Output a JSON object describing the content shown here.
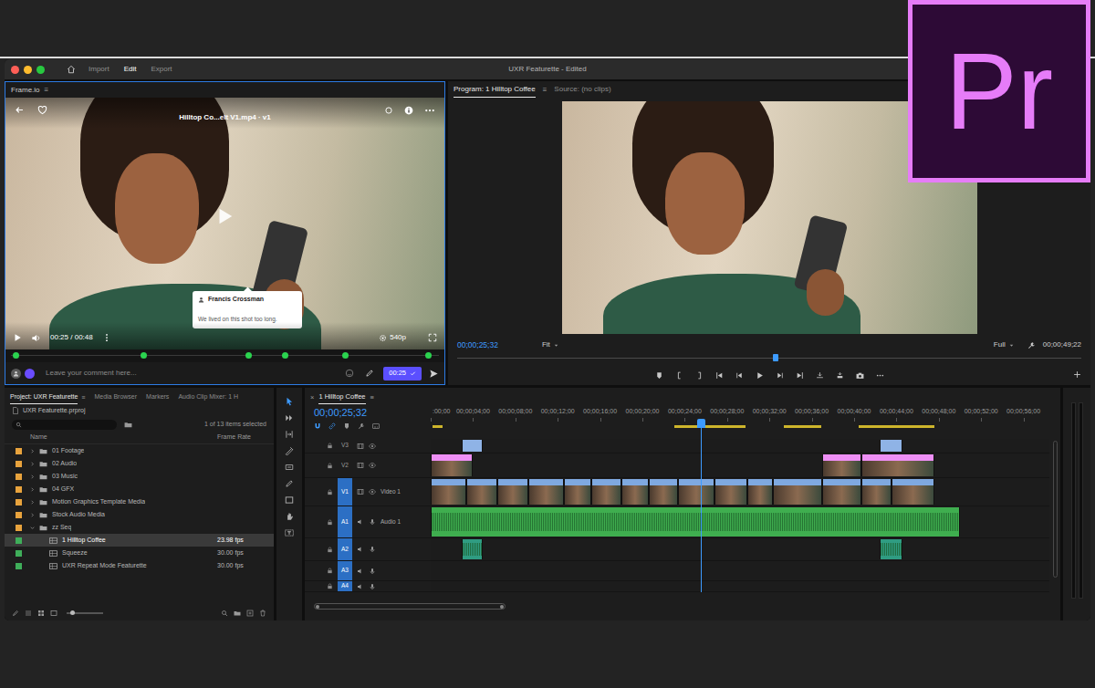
{
  "logo": "Pr",
  "app": {
    "title": "UXR Featurette - Edited",
    "nav": [
      {
        "label": "Import",
        "selected": false
      },
      {
        "label": "Edit",
        "selected": true
      },
      {
        "label": "Export",
        "selected": false
      }
    ]
  },
  "frameio": {
    "panel": "Frame.io",
    "menu": "≡",
    "file_title": "Hilltop Co...elt V1.mp4 · v1",
    "comment": {
      "author": "Francis Crossman",
      "text": "We lived on this shot too long."
    },
    "time": "00:25 / 00:48",
    "quality": "540p",
    "markers": [
      {
        "level": 0.01
      },
      {
        "level": 0.31
      },
      {
        "level": 0.555
      },
      {
        "level": 0.64
      },
      {
        "level": 0.78
      },
      {
        "level": 0.975
      }
    ],
    "input": {
      "placeholder": "Leave your comment here..."
    },
    "timestamp": "00:25"
  },
  "program": {
    "tabs": [
      {
        "label": "Program: 1 Hilltop Coffee",
        "selected": true
      },
      {
        "label": "Source: (no clips)",
        "selected": false
      }
    ],
    "menu": "≡",
    "timecode": "00;00;25;32",
    "zoom": "Fit",
    "resolution": "Full",
    "duration": "00;00;49;22",
    "playhead": {
      "level": 0.51
    }
  },
  "project": {
    "tabs": [
      {
        "label": "Project: UXR Featurette",
        "selected": true
      },
      {
        "label": "Media Browser",
        "selected": false
      },
      {
        "label": "Markers",
        "selected": false
      },
      {
        "label": "Audio Clip Mixer: 1 H",
        "selected": false
      }
    ],
    "menu": "≡",
    "file": "UXR Featurette.prproj",
    "count": "1 of 13 items selected",
    "columns": [
      "Name",
      "Frame Rate"
    ],
    "items": [
      {
        "name": "01 Footage",
        "kind": "folder",
        "expanded": false,
        "selected": false,
        "color": "#e8a33d"
      },
      {
        "name": "02 Audio",
        "kind": "folder",
        "expanded": false,
        "selected": false,
        "color": "#e8a33d"
      },
      {
        "name": "03 Music",
        "kind": "folder",
        "expanded": false,
        "selected": false,
        "color": "#e8a33d"
      },
      {
        "name": "04 GFX",
        "kind": "folder",
        "expanded": false,
        "selected": false,
        "color": "#e8a33d"
      },
      {
        "name": "Motion Graphics Template Media",
        "kind": "folder",
        "expanded": false,
        "selected": false,
        "color": "#e8a33d"
      },
      {
        "name": "Stock Audio Media",
        "kind": "folder",
        "expanded": false,
        "selected": false,
        "color": "#e8a33d"
      },
      {
        "name": "zz Seq",
        "kind": "folder",
        "expanded": true,
        "selected": false,
        "color": "#e8a33d"
      },
      {
        "name": "1 Hilltop Coffee",
        "kind": "sequence",
        "frame_rate": "23.98 fps",
        "selected": true,
        "color": "#3fae5a"
      },
      {
        "name": "Squeeze",
        "kind": "sequence",
        "frame_rate": "30.00 fps",
        "selected": false,
        "color": "#3fae5a"
      },
      {
        "name": "UXR Repeat Mode Featurette",
        "kind": "sequence",
        "frame_rate": "30.00 fps",
        "selected": false,
        "color": "#3fae5a"
      }
    ]
  },
  "timeline": {
    "close": "×",
    "tab": "1 Hilltop Coffee",
    "menu": "≡",
    "timecode": "00;00;25;32",
    "ruler": [
      ":00;00",
      "00;00;04;00",
      "00;00;08;00",
      "00;00;12;00",
      "00;00;16;00",
      "00;00;20;00",
      "00;00;24;00",
      "00;00;28;00",
      "00;00;32;00",
      "00;00;36;00",
      "00;00;40;00",
      "00;00;44;00",
      "00;00;48;00",
      "00;00;52;00",
      "00;00;56;00"
    ],
    "playhead": 25.5,
    "render_bars": [
      {
        "start": 0.2,
        "end": 1.1
      },
      {
        "start": 23,
        "end": 29.7
      },
      {
        "start": 33.4,
        "end": 36.9
      },
      {
        "start": 40.4,
        "end": 47.6
      }
    ],
    "tracks": [
      {
        "id": "V3",
        "name": "",
        "kind": "video",
        "patched": false,
        "color": "#8fb3e6",
        "clips": [
          {
            "start": 2.9,
            "end": 4.9
          },
          {
            "start": 42.4,
            "end": 44.6
          }
        ]
      },
      {
        "id": "V2",
        "name": "",
        "kind": "video",
        "patched": false,
        "color": "#ee8ff5",
        "clips": [
          {
            "start": 0,
            "end": 4
          },
          {
            "start": 37,
            "end": 40.7
          },
          {
            "start": 40.7,
            "end": 47.6
          }
        ]
      },
      {
        "id": "V1",
        "name": "Video 1",
        "kind": "video",
        "patched": true,
        "color": "#7fa9e0",
        "clips": [
          {
            "start": 0,
            "end": 3.4
          },
          {
            "start": 3.4,
            "end": 6.3
          },
          {
            "start": 6.3,
            "end": 9.2
          },
          {
            "start": 9.2,
            "end": 12.6
          },
          {
            "start": 12.6,
            "end": 15.2
          },
          {
            "start": 15.2,
            "end": 18
          },
          {
            "start": 18,
            "end": 20.6
          },
          {
            "start": 20.6,
            "end": 23.4
          },
          {
            "start": 23.4,
            "end": 26.8
          },
          {
            "start": 26.8,
            "end": 29.9
          },
          {
            "start": 29.9,
            "end": 32.3
          },
          {
            "start": 32.3,
            "end": 37
          },
          {
            "start": 37,
            "end": 40.7
          },
          {
            "start": 40.7,
            "end": 43.5
          },
          {
            "start": 43.5,
            "end": 47.6
          }
        ]
      },
      {
        "id": "A1",
        "name": "Audio 1",
        "kind": "audio",
        "patched": true,
        "color": "#3fae4f",
        "clips": [
          {
            "start": 0,
            "end": 50
          }
        ]
      },
      {
        "id": "A2",
        "name": "",
        "kind": "audio",
        "patched": true,
        "color": "#2f9c82",
        "clips": [
          {
            "start": 2.9,
            "end": 4.9
          },
          {
            "start": 42.4,
            "end": 44.6
          }
        ]
      },
      {
        "id": "A3",
        "name": "",
        "kind": "audio",
        "patched": true,
        "color": "#2f9c82",
        "clips": []
      },
      {
        "id": "A4",
        "name": "",
        "kind": "audio",
        "patched": true,
        "color": "#2f9c82",
        "clips": []
      }
    ]
  }
}
